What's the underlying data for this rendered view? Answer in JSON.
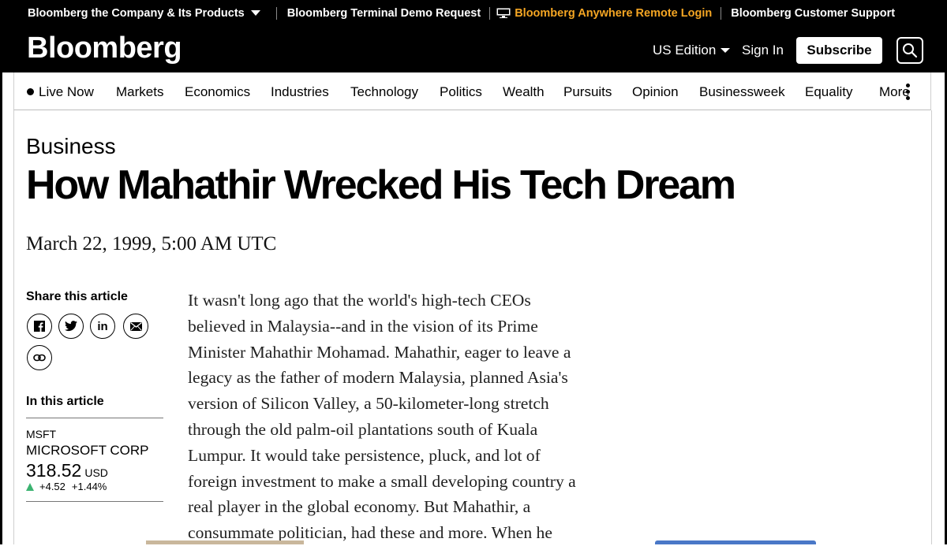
{
  "util_bar": {
    "company_products": "Bloomberg the Company & Its Products",
    "terminal_demo": "Bloomberg Terminal Demo Request",
    "anywhere_login": "Bloomberg Anywhere Remote Login",
    "customer_support": "Bloomberg Customer Support"
  },
  "header": {
    "logo": "Bloomberg",
    "edition": "US Edition",
    "sign_in": "Sign In",
    "subscribe": "Subscribe"
  },
  "nav": {
    "items": [
      "Live Now",
      "Markets",
      "Economics",
      "Industries",
      "Technology",
      "Politics",
      "Wealth",
      "Pursuits",
      "Opinion",
      "Businessweek",
      "Equality",
      "More"
    ]
  },
  "article": {
    "category": "Business",
    "headline": "How Mahathir Wrecked His Tech Dream",
    "date": "March 22, 1999, 5:00 AM UTC",
    "body_lines": [
      "It wasn't long ago that the world's high-tech CEOs",
      "believed in Malaysia--and in the vision of its Prime",
      "Minister Mahathir Mohamad. Mahathir, eager to leave a",
      "legacy as the father of modern Malaysia, planned Asia's",
      "version of Silicon Valley, a 50-kilometer-long stretch",
      "through the old palm-oil plantations south of Kuala",
      "Lumpur. It would take persistence, pluck, and lot of",
      "foreign investment to make a small developing country a",
      "real player in the global economy. But Mahathir, a",
      "consummate politician, had these and more. When he"
    ]
  },
  "share": {
    "title": "Share this article",
    "icons": [
      "facebook-icon",
      "twitter-icon",
      "linkedin-icon",
      "email-icon",
      "link-icon"
    ]
  },
  "in_this_article": {
    "title": "In this article",
    "ticker": "MSFT",
    "company": "MICROSOFT CORP",
    "price": "318.52",
    "currency": "USD",
    "change": "+4.52",
    "change_pct": "+1.44%",
    "up_color": "#3cb371"
  },
  "colors": {
    "accent_orange": "#f5a623",
    "header_bg": "#000000"
  }
}
